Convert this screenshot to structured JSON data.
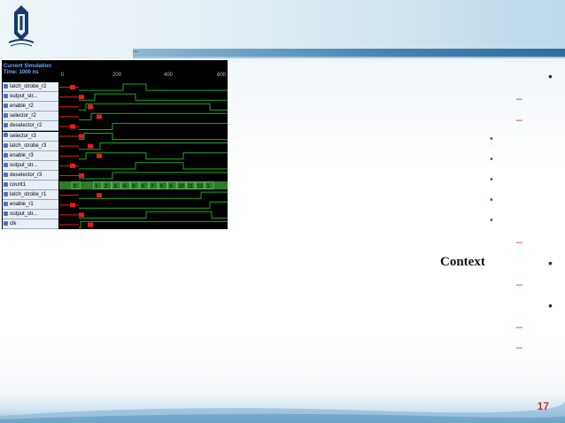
{
  "simulation": {
    "header_line1": "Current Simulation",
    "header_line2": "Time: 1000 ns",
    "ticks": [
      "0",
      "200",
      "400",
      "600"
    ],
    "signals": [
      "latch_strobe_r2",
      "output_str...",
      "enable_r2",
      "selector_r2",
      "deselector_r2",
      "selector_r3",
      "latch_strobe_r3",
      "enable_r3",
      "output_str...",
      "deselector_r3",
      "count1",
      "latch_strobe_r1",
      "enable_r1",
      "output_str...",
      "clk"
    ],
    "count_values": [
      "0",
      "1",
      "2",
      "3",
      "4",
      "5",
      "6",
      "7",
      "8",
      "9",
      "10",
      "11",
      "12",
      "1"
    ],
    "marker_label": "U"
  },
  "bullets": {
    "context_word": "Context",
    "bullet_symbol": "•",
    "dash_symbol": "–",
    "dot_symbol": "•"
  },
  "title_dash": "–",
  "page_number": "17",
  "colors": {
    "accent_red": "#c0392b",
    "wave_green": "#1ea81e",
    "wave_red": "#e02020",
    "bus_green": "#2e7d2e"
  }
}
